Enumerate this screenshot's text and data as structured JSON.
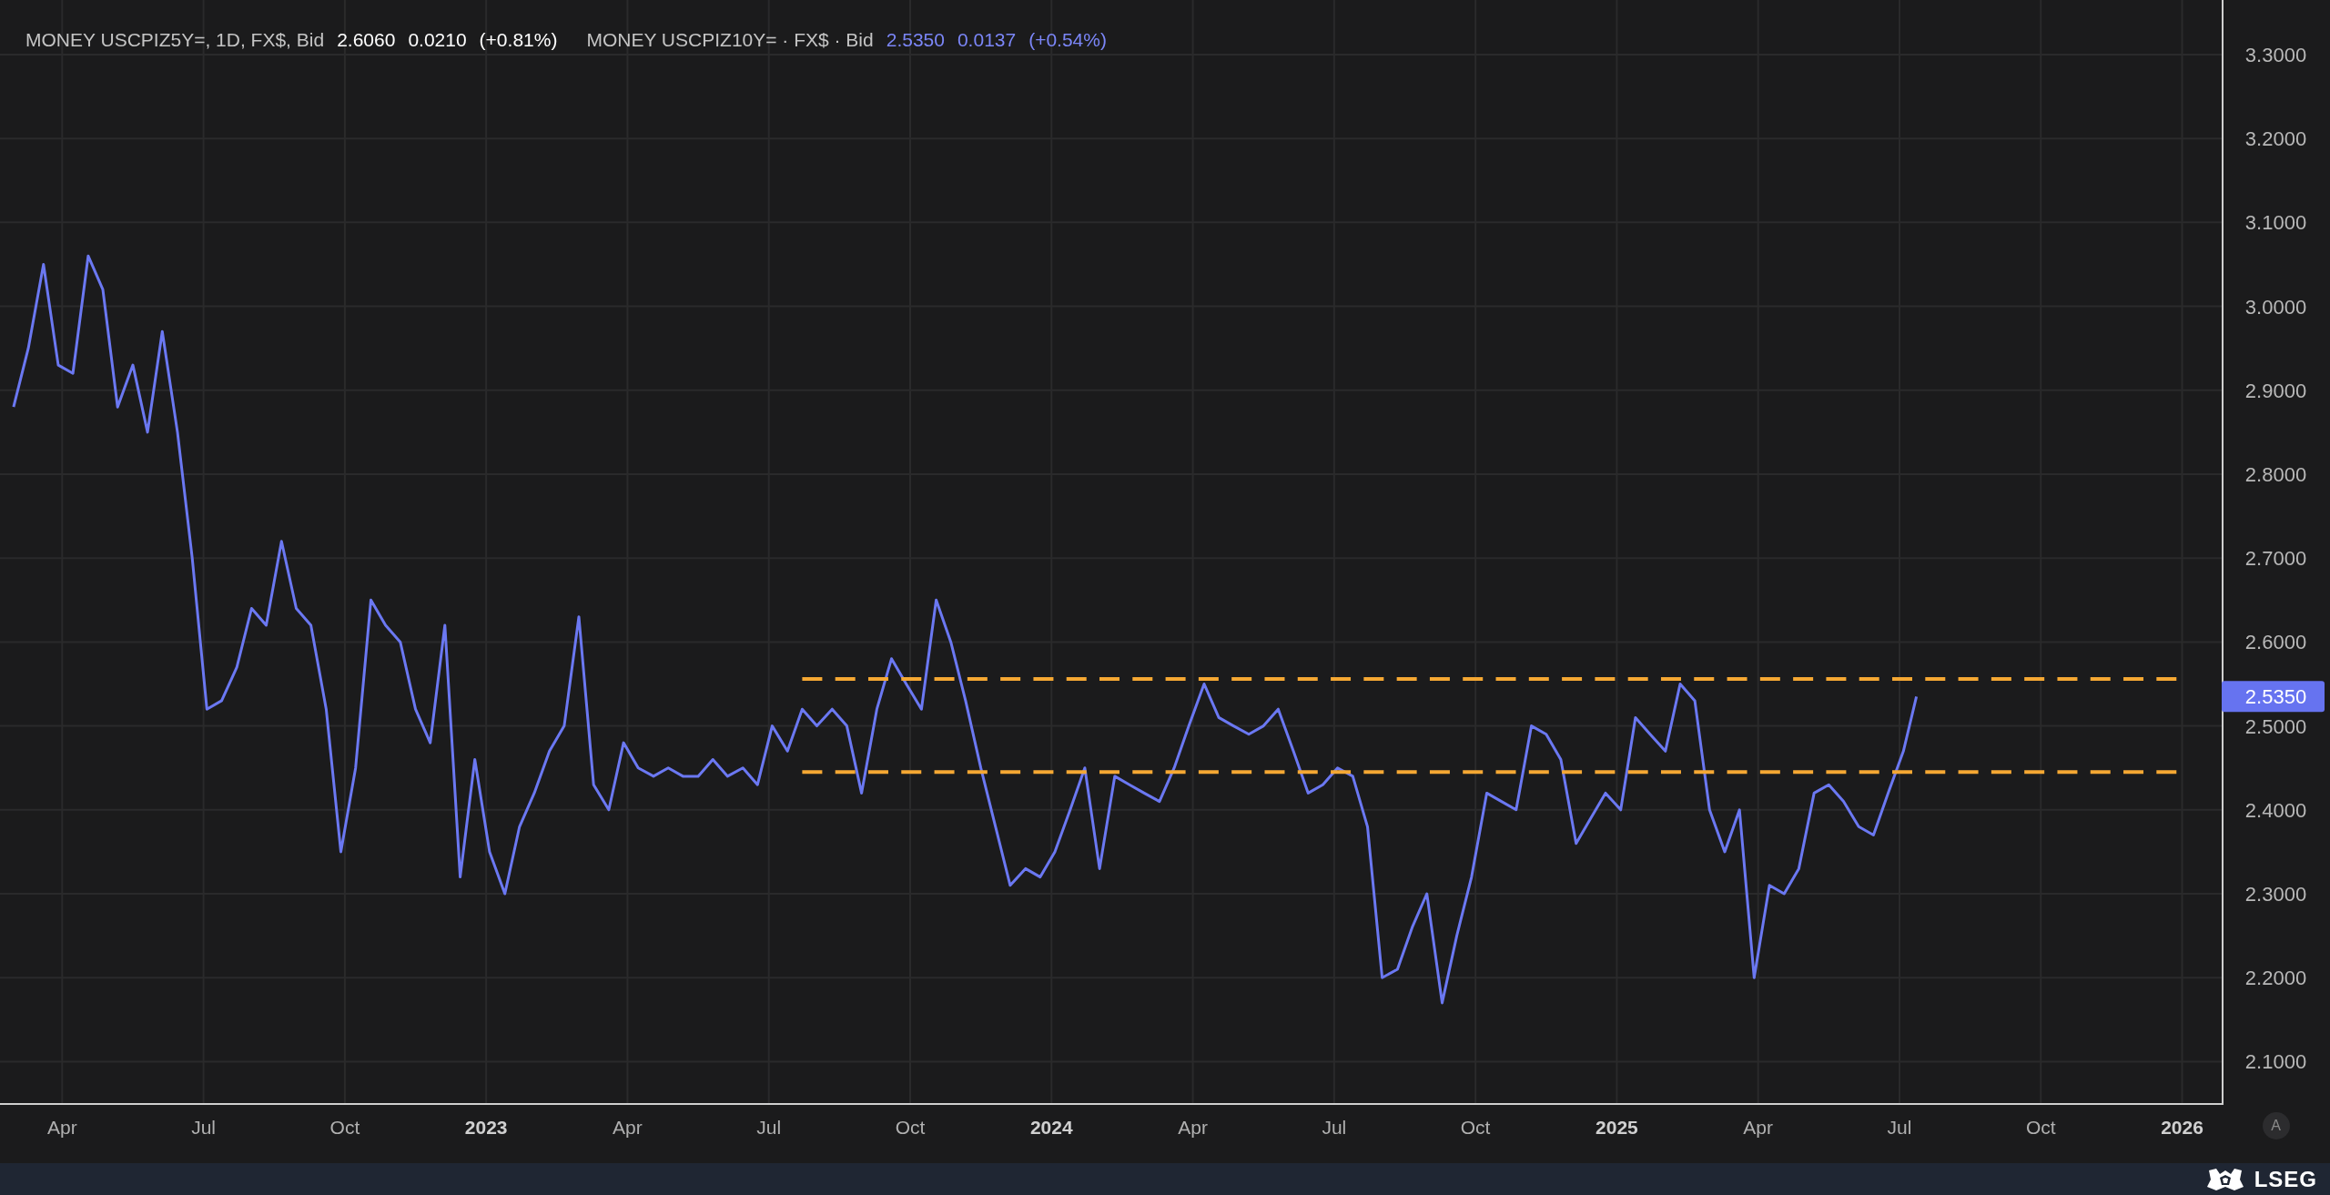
{
  "legend": [
    {
      "label": "MONEY USCPIZ5Y=, 1D, FX$, Bid",
      "value": "2.6060",
      "change": "0.0210",
      "pct": "(+0.81%)",
      "color": "#ffffff"
    },
    {
      "label": "MONEY USCPIZ10Y= · FX$ · Bid",
      "value": "2.5350",
      "change": "0.0137",
      "pct": "(+0.54%)",
      "color": "#7b86f7"
    }
  ],
  "chart_data": {
    "type": "line",
    "xlim": [
      2022.14,
      2026.07
    ],
    "ylim": [
      2.0506,
      3.365
    ],
    "xticks": [
      {
        "value": 2022.25,
        "label": "Apr"
      },
      {
        "value": 2022.5,
        "label": "Jul"
      },
      {
        "value": 2022.75,
        "label": "Oct"
      },
      {
        "value": 2023,
        "label": "2023"
      },
      {
        "value": 2023.25,
        "label": "Apr"
      },
      {
        "value": 2023.5,
        "label": "Jul"
      },
      {
        "value": 2023.75,
        "label": "Oct"
      },
      {
        "value": 2024,
        "label": "2024"
      },
      {
        "value": 2024.25,
        "label": "Apr"
      },
      {
        "value": 2024.5,
        "label": "Jul"
      },
      {
        "value": 2024.75,
        "label": "Oct"
      },
      {
        "value": 2025,
        "label": "2025"
      },
      {
        "value": 2025.25,
        "label": "Apr"
      },
      {
        "value": 2025.5,
        "label": "Jul"
      },
      {
        "value": 2025.75,
        "label": "Oct"
      },
      {
        "value": 2026,
        "label": "2026"
      }
    ],
    "yticks": [
      {
        "value": 2.1,
        "label": "2.1000"
      },
      {
        "value": 2.2,
        "label": "2.2000"
      },
      {
        "value": 2.3,
        "label": "2.3000"
      },
      {
        "value": 2.4,
        "label": "2.4000"
      },
      {
        "value": 2.5,
        "label": "2.5000"
      },
      {
        "value": 2.6,
        "label": "2.6000"
      },
      {
        "value": 2.7,
        "label": "2.7000"
      },
      {
        "value": 2.8,
        "label": "2.8000"
      },
      {
        "value": 2.9,
        "label": "2.9000"
      },
      {
        "value": 3.0,
        "label": "3.0000"
      },
      {
        "value": 3.1,
        "label": "3.1000"
      },
      {
        "value": 3.2,
        "label": "3.2000"
      },
      {
        "value": 3.3,
        "label": "3.3000"
      }
    ],
    "x": [
      2022.164,
      2022.19,
      2022.217,
      2022.243,
      2022.269,
      2022.296,
      2022.322,
      2022.348,
      2022.375,
      2022.401,
      2022.427,
      2022.454,
      2022.48,
      2022.506,
      2022.532,
      2022.559,
      2022.585,
      2022.611,
      2022.638,
      2022.664,
      2022.69,
      2022.717,
      2022.743,
      2022.769,
      2022.796,
      2022.822,
      2022.848,
      2022.875,
      2022.901,
      2022.927,
      2022.954,
      2022.98,
      2023.006,
      2023.033,
      2023.059,
      2023.085,
      2023.112,
      2023.138,
      2023.164,
      2023.19,
      2023.217,
      2023.243,
      2023.269,
      2023.296,
      2023.322,
      2023.348,
      2023.375,
      2023.401,
      2023.427,
      2023.454,
      2023.48,
      2023.506,
      2023.533,
      2023.559,
      2023.585,
      2023.612,
      2023.638,
      2023.664,
      2023.691,
      2023.717,
      2023.743,
      2023.77,
      2023.796,
      2023.822,
      2023.848,
      2023.875,
      2023.901,
      2023.927,
      2023.954,
      2023.98,
      2024.006,
      2024.033,
      2024.059,
      2024.085,
      2024.112,
      2024.138,
      2024.164,
      2024.191,
      2024.217,
      2024.243,
      2024.27,
      2024.296,
      2024.322,
      2024.349,
      2024.375,
      2024.401,
      2024.428,
      2024.454,
      2024.48,
      2024.506,
      2024.533,
      2024.559,
      2024.585,
      2024.612,
      2024.638,
      2024.664,
      2024.691,
      2024.717,
      2024.743,
      2024.77,
      2024.796,
      2024.822,
      2024.849,
      2024.875,
      2024.901,
      2024.928,
      2024.954,
      2024.98,
      2025.007,
      2025.033,
      2025.059,
      2025.086,
      2025.112,
      2025.138,
      2025.164,
      2025.191,
      2025.217,
      2025.243,
      2025.27,
      2025.296,
      2025.322,
      2025.349,
      2025.375,
      2025.401,
      2025.428,
      2025.454,
      2025.48,
      2025.507,
      2025.53,
      2025.99
    ],
    "series": [
      {
        "line_style": "solid",
        "color": "#6b78f2",
        "values": [
          2.88,
          2.95,
          3.05,
          2.93,
          2.92,
          3.06,
          3.02,
          2.88,
          2.93,
          2.85,
          2.97,
          2.85,
          2.7,
          2.52,
          2.53,
          2.57,
          2.64,
          2.62,
          2.72,
          2.64,
          2.62,
          2.52,
          2.35,
          2.45,
          2.65,
          2.62,
          2.6,
          2.52,
          2.48,
          2.62,
          2.32,
          2.46,
          2.35,
          2.3,
          2.38,
          2.42,
          2.47,
          2.5,
          2.63,
          2.43,
          2.4,
          2.48,
          2.45,
          2.44,
          2.45,
          2.44,
          2.44,
          2.46,
          2.44,
          2.45,
          2.43,
          2.5,
          2.47,
          2.52,
          2.5,
          2.52,
          2.5,
          2.42,
          2.52,
          2.58,
          2.55,
          2.52,
          2.65,
          2.6,
          2.53,
          2.45,
          2.38,
          2.31,
          2.33,
          2.32,
          2.35,
          2.4,
          2.45,
          2.33,
          2.44,
          2.43,
          2.42,
          2.41,
          2.45,
          2.5,
          2.55,
          2.51,
          2.5,
          2.49,
          2.5,
          2.52,
          2.47,
          2.42,
          2.43,
          2.45,
          2.44,
          2.38,
          2.2,
          2.21,
          2.26,
          2.3,
          2.17,
          2.25,
          2.32,
          2.42,
          2.41,
          2.4,
          2.5,
          2.49,
          2.46,
          2.36,
          2.39,
          2.42,
          2.4,
          2.51,
          2.49,
          2.47,
          2.55,
          2.53,
          2.4,
          2.35,
          2.4,
          2.2,
          2.31,
          2.3,
          2.33,
          2.42,
          2.43,
          2.41,
          2.38,
          2.37,
          2.42,
          2.47,
          2.535,
          null
        ]
      },
      {
        "line_style": "dashed",
        "color": "#f5a833",
        "values": [
          null,
          null,
          null,
          null,
          null,
          null,
          null,
          null,
          null,
          null,
          null,
          null,
          null,
          null,
          null,
          null,
          null,
          null,
          null,
          null,
          null,
          null,
          null,
          null,
          null,
          null,
          null,
          null,
          null,
          null,
          null,
          null,
          null,
          null,
          null,
          null,
          null,
          null,
          null,
          null,
          null,
          null,
          null,
          null,
          null,
          null,
          null,
          null,
          null,
          null,
          null,
          null,
          null,
          2.556,
          2.556,
          2.556,
          2.556,
          2.556,
          2.556,
          2.556,
          2.556,
          2.556,
          2.556,
          2.556,
          2.556,
          2.556,
          2.556,
          2.556,
          2.556,
          2.556,
          2.556,
          2.556,
          2.556,
          2.556,
          2.556,
          2.556,
          2.556,
          2.556,
          2.556,
          2.556,
          2.556,
          2.556,
          2.556,
          2.556,
          2.556,
          2.556,
          2.556,
          2.556,
          2.556,
          2.556,
          2.556,
          2.556,
          2.556,
          2.556,
          2.556,
          2.556,
          2.556,
          2.556,
          2.556,
          2.556,
          2.556,
          2.556,
          2.556,
          2.556,
          2.556,
          2.556,
          2.556,
          2.556,
          2.556,
          2.556,
          2.556,
          2.556,
          2.556,
          2.556,
          2.556,
          2.556,
          2.556,
          2.556,
          2.556,
          2.556,
          2.556,
          2.556,
          2.556,
          2.556,
          2.556,
          2.556,
          2.556,
          2.556,
          2.556,
          2.556
        ]
      },
      {
        "line_style": "dashed",
        "color": "#f5a833",
        "values": [
          null,
          null,
          null,
          null,
          null,
          null,
          null,
          null,
          null,
          null,
          null,
          null,
          null,
          null,
          null,
          null,
          null,
          null,
          null,
          null,
          null,
          null,
          null,
          null,
          null,
          null,
          null,
          null,
          null,
          null,
          null,
          null,
          null,
          null,
          null,
          null,
          null,
          null,
          null,
          null,
          null,
          null,
          null,
          null,
          null,
          null,
          null,
          null,
          null,
          null,
          null,
          null,
          null,
          2.445,
          2.445,
          2.445,
          2.445,
          2.445,
          2.445,
          2.445,
          2.445,
          2.445,
          2.445,
          2.445,
          2.445,
          2.445,
          2.445,
          2.445,
          2.445,
          2.445,
          2.445,
          2.445,
          2.445,
          2.445,
          2.445,
          2.445,
          2.445,
          2.445,
          2.445,
          2.445,
          2.445,
          2.445,
          2.445,
          2.445,
          2.445,
          2.445,
          2.445,
          2.445,
          2.445,
          2.445,
          2.445,
          2.445,
          2.445,
          2.445,
          2.445,
          2.445,
          2.445,
          2.445,
          2.445,
          2.445,
          2.445,
          2.445,
          2.445,
          2.445,
          2.445,
          2.445,
          2.445,
          2.445,
          2.445,
          2.445,
          2.445,
          2.445,
          2.445,
          2.445,
          2.445,
          2.445,
          2.445,
          2.445,
          2.445,
          2.445,
          2.445,
          2.445,
          2.445,
          2.445,
          2.445,
          2.445,
          2.445,
          2.445,
          2.445,
          2.445
        ]
      }
    ],
    "grid": true
  },
  "last_price": {
    "label": "2.5350",
    "color": "#6673f0"
  },
  "autoscale_button": "A",
  "logo": "LSEG"
}
